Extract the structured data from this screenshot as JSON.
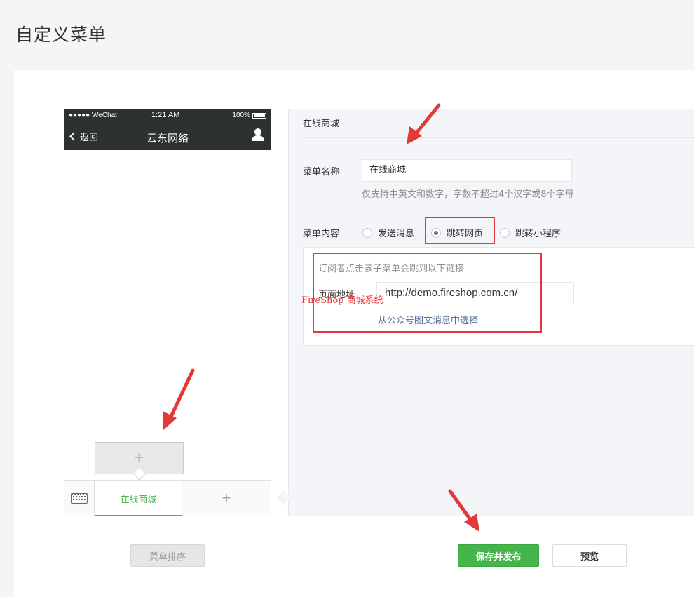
{
  "page": {
    "title": "自定义菜单"
  },
  "phone": {
    "status": {
      "carrier": "●●●●● WeChat",
      "time": "1:21 AM",
      "battery": "100%"
    },
    "nav": {
      "back": "返回",
      "title": "云东网络"
    },
    "menu_bar": {
      "active_item": "在线商城"
    }
  },
  "editor": {
    "header": "在线商城",
    "name_label": "菜单名称",
    "name_value": "在线商城",
    "name_hint": "仅支持中英文和数字，字数不超过4个汉字或8个字母",
    "content_label": "菜单内容",
    "options": [
      {
        "label": "发送消息",
        "checked": false
      },
      {
        "label": "跳转网页",
        "checked": true
      },
      {
        "label": "跳转小程序",
        "checked": false
      }
    ],
    "link_desc": "订阅者点击该子菜单会跳到以下链接",
    "url_label": "页面地址",
    "url_value": "http://demo.fireshop.com.cn/",
    "pick_link": "从公众号图文消息中选择"
  },
  "watermark": "FireShop 商城系统",
  "buttons": {
    "sort": "菜单排序",
    "save": "保存并发布",
    "preview": "预览"
  },
  "colors": {
    "accent_green": "#44b549",
    "highlight_red": "#e0383e",
    "link_blue": "#576b95"
  }
}
